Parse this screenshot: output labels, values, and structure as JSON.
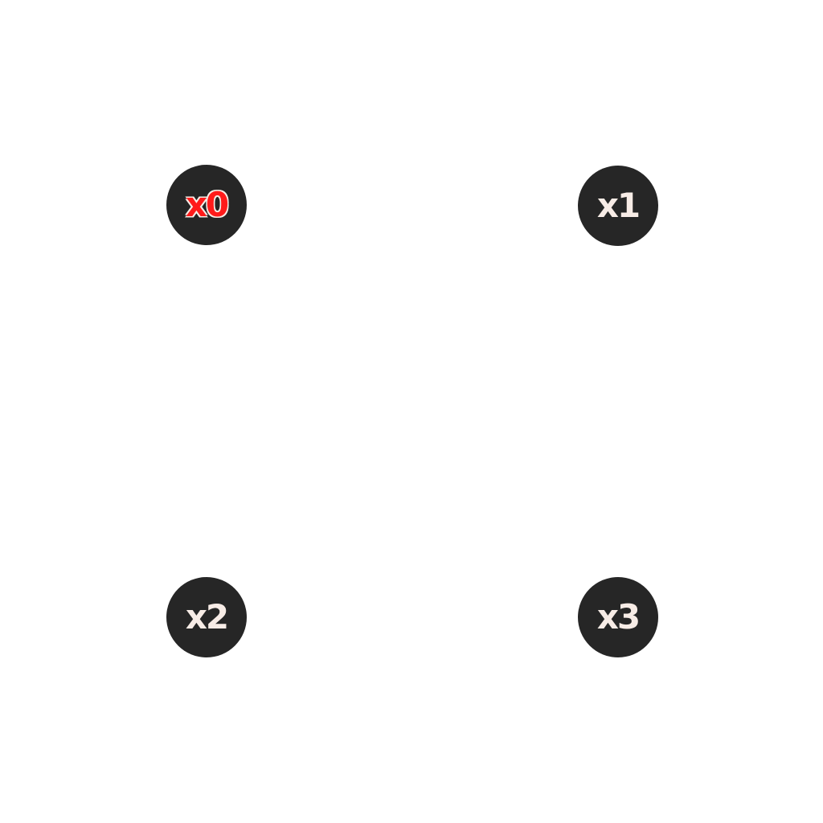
{
  "colors": {
    "background": "#ffffff",
    "button_fill": "#262626",
    "label_default": "#f7ece6",
    "label_selected": "#ff1a1a"
  },
  "buttons": [
    {
      "label": "x0",
      "selected": true
    },
    {
      "label": "x1",
      "selected": false
    },
    {
      "label": "x2",
      "selected": false
    },
    {
      "label": "x3",
      "selected": false
    }
  ]
}
